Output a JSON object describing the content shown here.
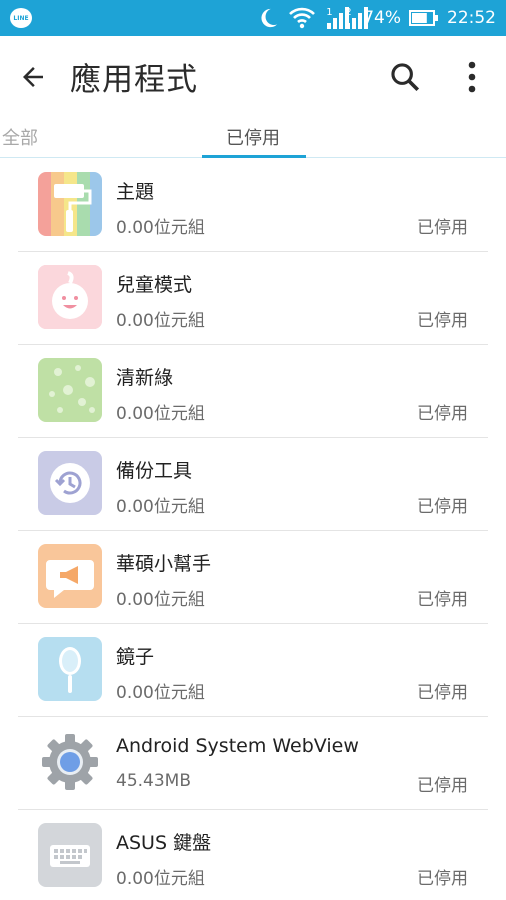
{
  "status_bar": {
    "left_icon": "line-app-icon",
    "left_icon_text": "LINE",
    "icons": [
      "moon-icon",
      "wifi-icon",
      "signal-1-icon",
      "signal-2-icon",
      "battery-icon"
    ],
    "signal_1_label": "1",
    "signal_2_label": "2",
    "battery": "74%",
    "battery_level": 0.74,
    "time": "22:52",
    "background": "#1ea3d6"
  },
  "appbar": {
    "title": "應用程式",
    "back_icon": "arrow-back-icon",
    "search_icon": "search-icon",
    "menu_icon": "more-vert-icon"
  },
  "tabs": [
    {
      "label": "全部",
      "selected": false
    },
    {
      "label": "已停用",
      "selected": true
    }
  ],
  "accent": "#1ea3d6",
  "apps": [
    {
      "name": "主題",
      "size": "0.00位元組",
      "status": "已停用",
      "icon": "theme-icon"
    },
    {
      "name": "兒童模式",
      "size": "0.00位元組",
      "status": "已停用",
      "icon": "kids-mode-icon"
    },
    {
      "name": "清新綠",
      "size": "0.00位元組",
      "status": "已停用",
      "icon": "fresh-green-icon"
    },
    {
      "name": "備份工具",
      "size": "0.00位元組",
      "status": "已停用",
      "icon": "backup-icon"
    },
    {
      "name": "華碩小幫手",
      "size": "0.00位元組",
      "status": "已停用",
      "icon": "zenui-help-icon"
    },
    {
      "name": "鏡子",
      "size": "0.00位元組",
      "status": "已停用",
      "icon": "mirror-icon"
    },
    {
      "name": "Android System WebView",
      "size": "45.43MB",
      "status": "已停用",
      "icon": "webview-gear-icon"
    },
    {
      "name": "ASUS 鍵盤",
      "size": "0.00位元組",
      "status": "已停用",
      "icon": "keyboard-icon"
    }
  ]
}
